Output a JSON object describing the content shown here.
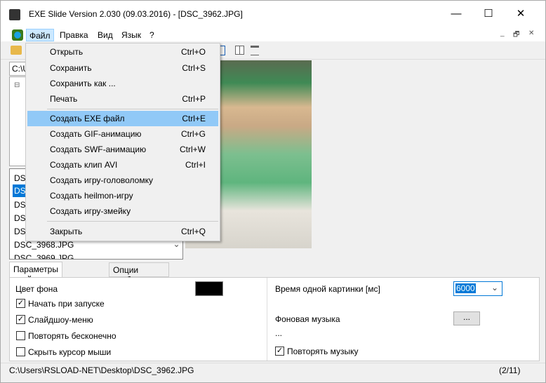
{
  "window": {
    "title": "EXE Slide Version 2.030 (09.03.2016) - [DSC_3962.JPG]",
    "minimize": "—",
    "maximize": "☐",
    "close": "✕"
  },
  "menubar": [
    "Файл",
    "Правка",
    "Вид",
    "Язык",
    "?"
  ],
  "mdi": {
    "min": "_",
    "restore": "🗗",
    "close": "✕"
  },
  "path_value": "C:\\U",
  "file_list": [
    "DSC",
    "DSC",
    "DSC",
    "DSC",
    "DSC",
    "DSC_3968.JPG",
    "DSC_3969.JPG"
  ],
  "file_menu": [
    {
      "label": "Открыть",
      "shortcut": "Ctrl+O"
    },
    {
      "label": "Сохранить",
      "shortcut": "Ctrl+S"
    },
    {
      "label": "Сохранить как ...",
      "shortcut": ""
    },
    {
      "label": "Печать",
      "shortcut": "Ctrl+P"
    },
    {
      "label": "Создать EXE файл",
      "shortcut": "Ctrl+E"
    },
    {
      "label": "Создать GIF-анимацию",
      "shortcut": "Ctrl+G"
    },
    {
      "label": "Создать SWF-анимацию",
      "shortcut": "Ctrl+W"
    },
    {
      "label": "Создать клип AVI",
      "shortcut": "Ctrl+I"
    },
    {
      "label": "Создать игру-головоломку",
      "shortcut": ""
    },
    {
      "label": "Создать heilmon-игру",
      "shortcut": ""
    },
    {
      "label": "Создать игру-змейку",
      "shortcut": ""
    },
    {
      "label": "Закрыть",
      "shortcut": "Ctrl+Q"
    }
  ],
  "tabs": [
    "Параметры слайд-шоу",
    "Опции изображения"
  ],
  "settings": {
    "bg_color_label": "Цвет фона",
    "bg_color": "#000000",
    "start_on_launch": "Начать при запуске",
    "slideshow_menu": "Слайдшоу-меню",
    "repeat_forever": "Повторять бесконечно",
    "hide_cursor": "Скрыть курсор мыши",
    "time_label": "Время одной картинки [мс]",
    "time_value": "6000",
    "music_label": "Фоновая музыка",
    "music_button": "...",
    "music_value": "...",
    "repeat_music": "Повторять музыку"
  },
  "status": {
    "path": "C:\\Users\\RSLOAD-NET\\Desktop\\DSC_3962.JPG",
    "count": "(2/11)"
  }
}
